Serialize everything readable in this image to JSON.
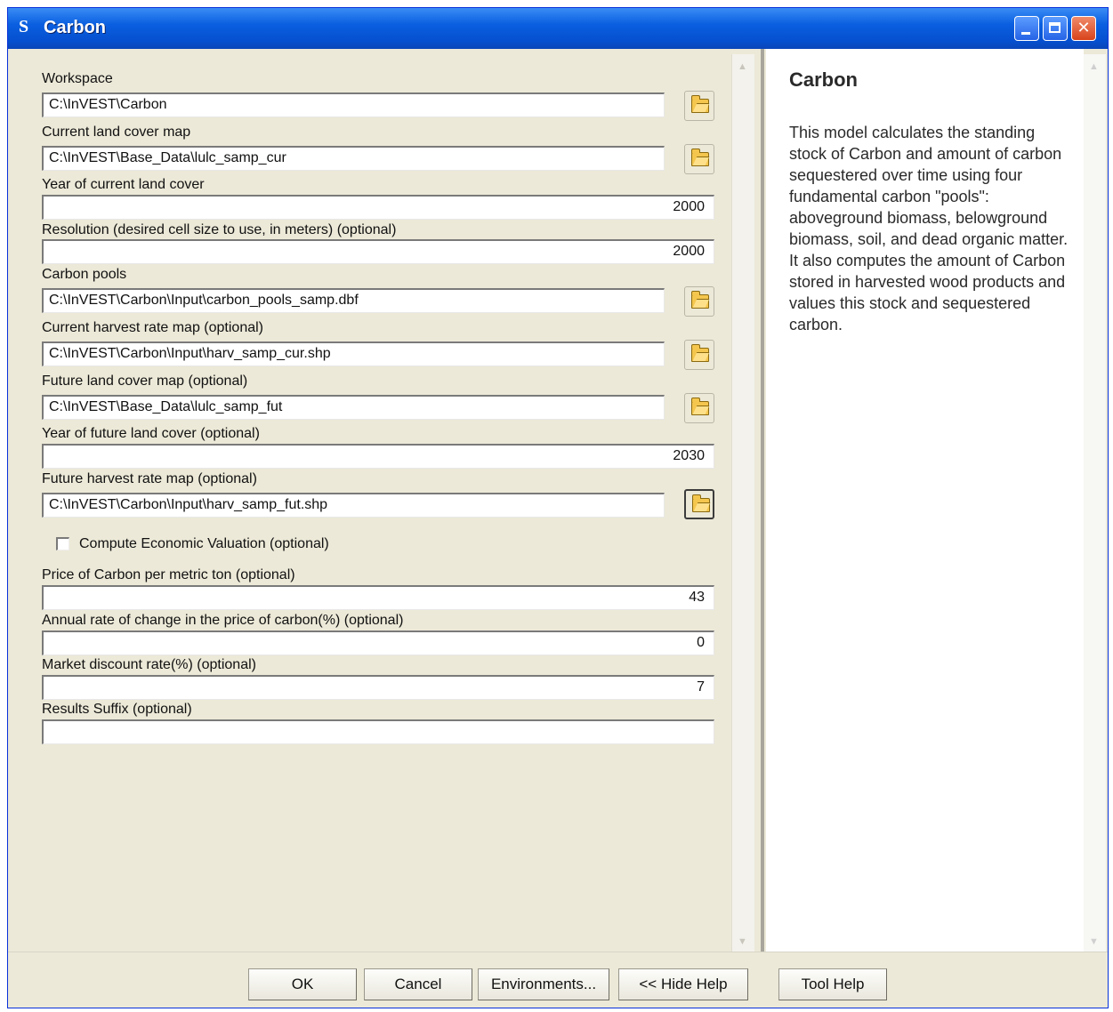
{
  "window": {
    "title": "Carbon",
    "icon": "S"
  },
  "titlebar_buttons": {
    "close_glyph": "✕"
  },
  "form": {
    "workspace": {
      "label": "Workspace",
      "value": "C:\\InVEST\\Carbon"
    },
    "current_lulc": {
      "label": "Current land cover map",
      "value": "C:\\InVEST\\Base_Data\\lulc_samp_cur"
    },
    "current_year": {
      "label": "Year of current land cover",
      "value": "2000"
    },
    "resolution": {
      "label": "Resolution (desired cell size to use, in meters) (optional)",
      "value": "2000"
    },
    "carbon_pools": {
      "label": "Carbon pools",
      "value": "C:\\InVEST\\Carbon\\Input\\carbon_pools_samp.dbf"
    },
    "current_harvest": {
      "label": "Current harvest rate map (optional)",
      "value": "C:\\InVEST\\Carbon\\Input\\harv_samp_cur.shp"
    },
    "future_lulc": {
      "label": "Future land cover map (optional)",
      "value": "C:\\InVEST\\Base_Data\\lulc_samp_fut"
    },
    "future_year": {
      "label": "Year of future land cover (optional)",
      "value": "2030"
    },
    "future_harvest": {
      "label": "Future harvest rate map (optional)",
      "value": "C:\\InVEST\\Carbon\\Input\\harv_samp_fut.shp"
    },
    "valuation": {
      "label": "Compute Economic Valuation (optional)",
      "checked": false
    },
    "price": {
      "label": "Price of Carbon per metric ton (optional)",
      "value": "43"
    },
    "price_change": {
      "label": "Annual rate of change in the price of carbon(%) (optional)",
      "value": "0"
    },
    "discount": {
      "label": "Market discount rate(%) (optional)",
      "value": "7"
    },
    "suffix": {
      "label": "Results Suffix (optional)",
      "value": ""
    }
  },
  "help": {
    "title": "Carbon",
    "body": "This model calculates the standing stock of Carbon and amount of carbon sequestered over time using four fundamental carbon \"pools\": aboveground biomass, belowground biomass, soil, and dead organic matter. It also computes the amount of Carbon stored in harvested wood products and values this stock and sequestered carbon."
  },
  "buttons": {
    "ok": "OK",
    "cancel": "Cancel",
    "environments": "Environments...",
    "hide_help": "<< Hide Help",
    "tool_help": "Tool Help"
  },
  "icons": {
    "browse": "open-folder-icon",
    "scroll_up": "▲",
    "scroll_down": "▼"
  }
}
